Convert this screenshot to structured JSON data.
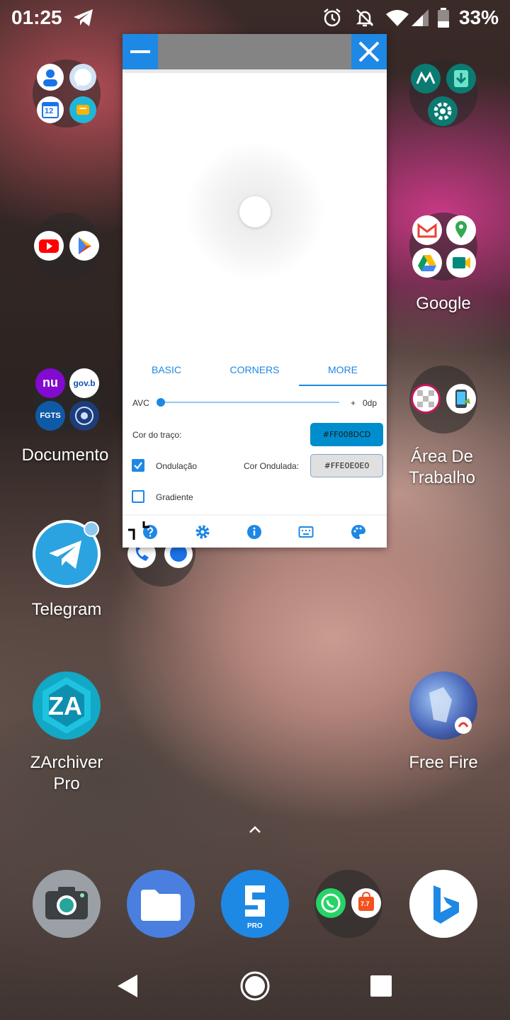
{
  "status": {
    "time": "01:25",
    "battery": "33%",
    "icons": [
      "telegram-icon",
      "alarm-icon",
      "notifications-off-icon",
      "wifi-icon",
      "signal-icon",
      "battery-icon"
    ]
  },
  "home": {
    "folder_documento": "Documento",
    "folder_google": "Google",
    "folder_area": "Área De\nTrabalho",
    "app_telegram": "Telegram",
    "app_zarchiver": "ZArchiver\nPro",
    "app_freefire": "Free Fire",
    "drawer_icon": "chevron-up-icon",
    "nubank_text": "nu",
    "govbr_text": "gov.b",
    "fgts_text": "FGTS",
    "calendar_text": "12",
    "zarchiver_logo": "ZA",
    "sketchware_pro": "PRO",
    "shopee_text": "7.7"
  },
  "window": {
    "tabs": [
      "BASIC",
      "CORNERS",
      "MORE"
    ],
    "active_tab": "MORE",
    "avc_label": "AVC",
    "avc_plus": "+",
    "avc_value": "0dp",
    "avc_fraction": 0,
    "stroke_label": "Cor do traço:",
    "stroke_color": "#FF008DCD",
    "ripple_label": "Ondulação",
    "ripple_checked": true,
    "ripple_color_label": "Cor Ondulada:",
    "ripple_color": "#FFE0E0E0",
    "gradient_label": "Gradiente",
    "gradient_checked": false,
    "bottom_icons": [
      "help-icon",
      "settings-icon",
      "info-icon",
      "keyboard-icon",
      "palette-icon"
    ]
  },
  "colors": {
    "accent": "#1e88e5",
    "stroke_btn": "#008dcd",
    "ripple_btn": "#e0e0e0",
    "titlebar": "#848484"
  },
  "navbar": [
    "back-icon",
    "home-icon",
    "recents-icon"
  ]
}
